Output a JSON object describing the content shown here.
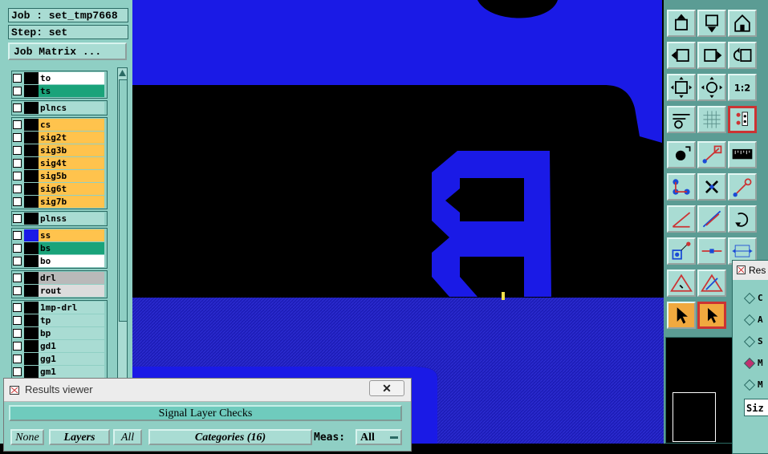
{
  "job_panel": {
    "job_line": "Job : set_tmp7668",
    "step_line": "Step: set",
    "job_matrix_label": "Job Matrix ..."
  },
  "layers": [
    {
      "name": "to",
      "color": "#ffffff"
    },
    {
      "name": "ts",
      "color": "#1aa37a"
    },
    {
      "name": "plncs",
      "color": "#a9dcd3"
    },
    {
      "name": "cs",
      "color": "#ffc34d"
    },
    {
      "name": "sig2t",
      "color": "#ffc34d"
    },
    {
      "name": "sig3b",
      "color": "#ffc34d"
    },
    {
      "name": "sig4t",
      "color": "#ffc34d"
    },
    {
      "name": "sig5b",
      "color": "#ffc34d"
    },
    {
      "name": "sig6t",
      "color": "#ffc34d"
    },
    {
      "name": "sig7b",
      "color": "#ffc34d"
    },
    {
      "name": "plnss",
      "color": "#a9dcd3"
    },
    {
      "name": "ss",
      "color": "#ffc34d"
    },
    {
      "name": "bs",
      "color": "#1aa37a"
    },
    {
      "name": "bo",
      "color": "#ffffff"
    },
    {
      "name": "drl",
      "color": "#b9b9b9"
    },
    {
      "name": "rout",
      "color": "#dcdcdc"
    },
    {
      "name": "1mp-drl",
      "color": "#a9dcd3"
    },
    {
      "name": "tp",
      "color": "#a9dcd3"
    },
    {
      "name": "bp",
      "color": "#a9dcd3"
    },
    {
      "name": "gd1",
      "color": "#a9dcd3"
    },
    {
      "name": "gg1",
      "color": "#a9dcd3"
    },
    {
      "name": "gm1",
      "color": "#a9dcd3"
    }
  ],
  "results_viewer": {
    "title": "Results viewer",
    "close_label": "✕",
    "header": "Signal Layer Checks",
    "none_label": "None",
    "layers_label": "Layers",
    "all_label": "All",
    "categories_label": "Categories (16)",
    "meas_label": "Meas:",
    "meas_value": "All"
  },
  "results_window_2": {
    "title": "Res",
    "options": [
      "C",
      "A",
      "S",
      "M",
      "M"
    ],
    "size_label": "Siz"
  },
  "colors": {
    "copper_blue": "#1a1ae6",
    "panel_teal": "#8fcfc4",
    "highlight_orange": "#f1a93f"
  }
}
